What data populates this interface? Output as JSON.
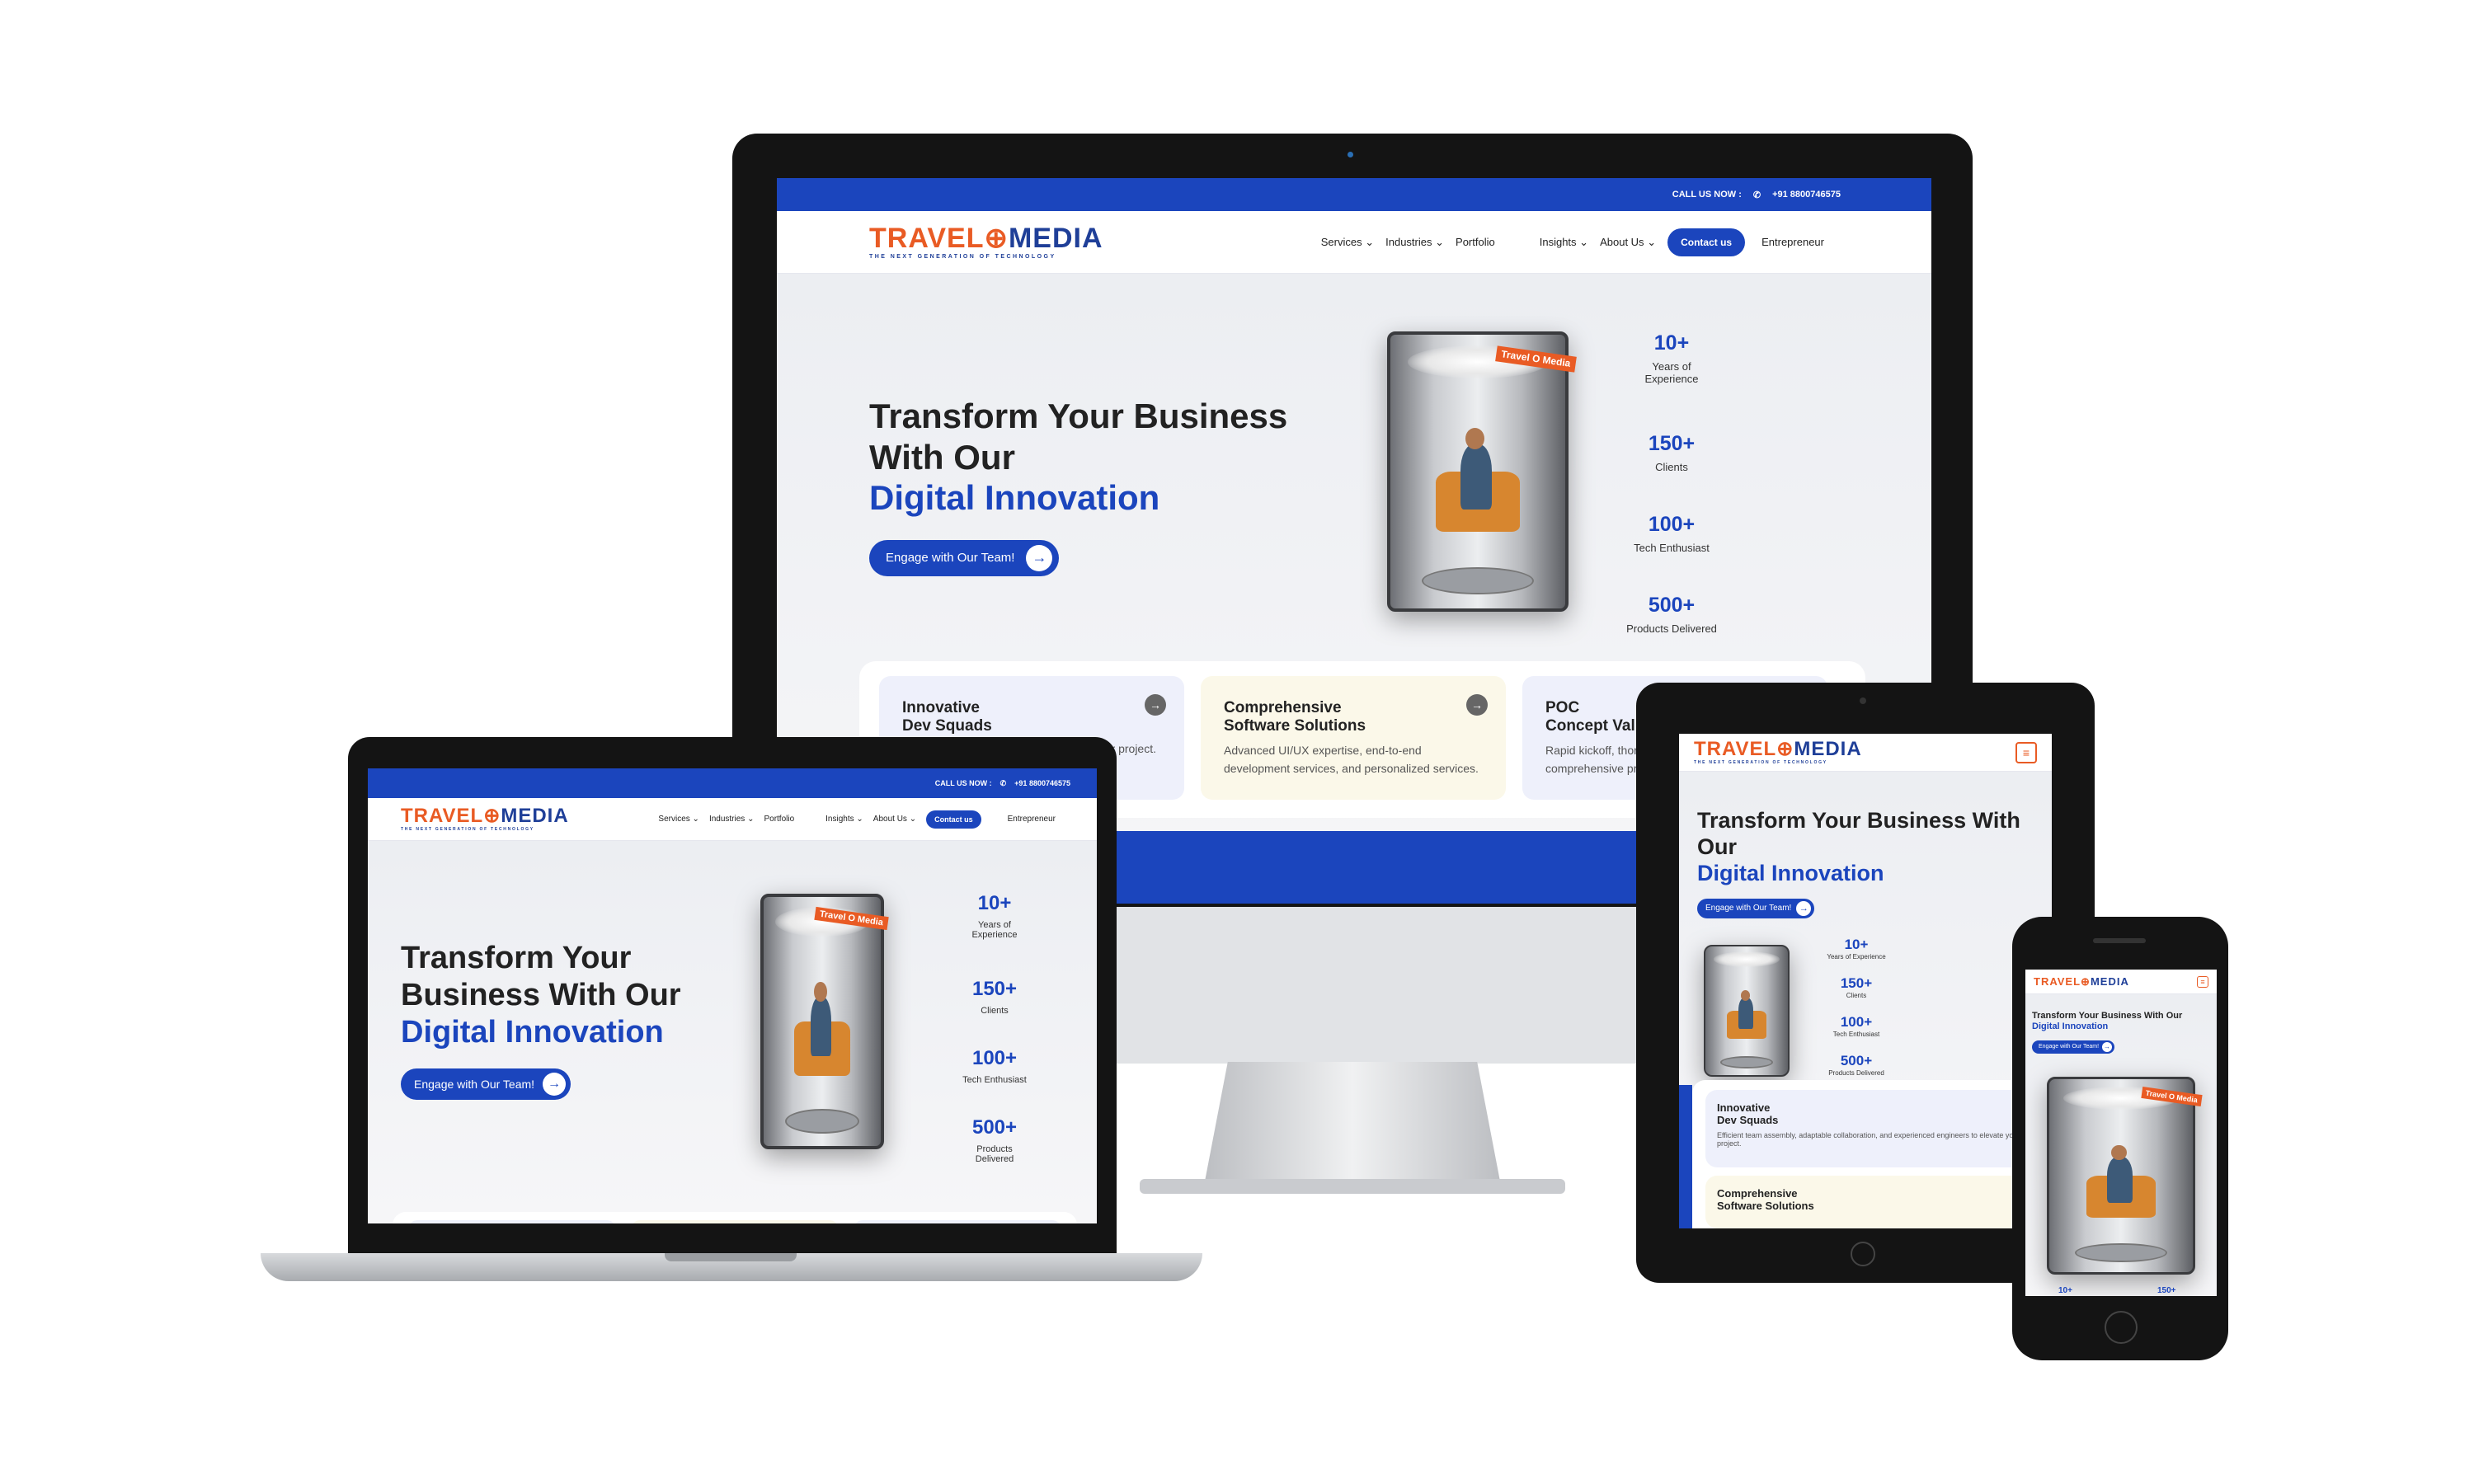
{
  "site": {
    "call_label": "CALL US NOW :",
    "phone": "+91 8800746575",
    "logo_left": "TRAVEL",
    "logo_right": "MEDIA",
    "logo_tagline": "THE NEXT GENERATION OF TECHNOLOGY",
    "nav": [
      "Services",
      "Industries",
      "Portfolio",
      "Insights",
      "About Us"
    ],
    "contact": "Contact us",
    "entrepreneur": "Entrepreneur",
    "hero_line1": "Transform Your Business",
    "hero_line2": "With Our",
    "hero_line1_laptop": "Transform Your",
    "hero_line2_laptop": "Business With Our",
    "hero_line1_tablet": "Transform Your Business With",
    "hero_line2_tablet": "Our",
    "hero_phone": "Transform Your Business With Our",
    "hero_blue": "Digital Innovation",
    "cta": "Engage with Our Team!",
    "booth_badge": "Travel O Media",
    "stats": [
      {
        "num": "10+",
        "label": "Years of Experience"
      },
      {
        "num": "150+",
        "label": "Clients"
      },
      {
        "num": "100+",
        "label": "Tech Enthusiast"
      },
      {
        "num": "500+",
        "label": "Products Delivered"
      }
    ],
    "cards": [
      {
        "title1": "Innovative",
        "title2": "Dev Squads",
        "desc": "Efficient team assembly, adaptable collaboration, and experienced engineers to elevate your project."
      },
      {
        "title1": "Comprehensive",
        "title2": "Software Solutions",
        "desc": "Advanced UI/UX expertise, end-to-end development services, and personalized services."
      },
      {
        "title1": "POC",
        "title2": "Concept Vali",
        "desc": "Rapid kickoff, thor comprehensive pr"
      }
    ],
    "desktop_card1_desc_visible": "oration, ur project.",
    "phone_stats_partial": [
      "10+",
      "150+"
    ]
  },
  "colors": {
    "brand_blue": "#1b45bd",
    "brand_orange": "#e95b24"
  },
  "icons": {
    "phone": "phone-icon",
    "arrow": "arrow-right-icon",
    "chevron": "chevron-down-icon",
    "menu": "hamburger-menu-icon"
  }
}
